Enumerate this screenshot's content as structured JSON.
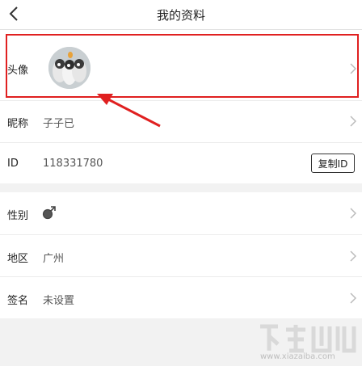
{
  "header": {
    "title": "我的资料"
  },
  "profile": {
    "avatar": {
      "label": "头像"
    },
    "nickname": {
      "label": "昵称",
      "value": "子子已"
    },
    "id": {
      "label": "ID",
      "value": "118331780",
      "copy_label": "复制ID"
    },
    "gender": {
      "label": "性别",
      "icon": "male-symbol-icon"
    },
    "region": {
      "label": "地区",
      "value": "广州"
    },
    "signature": {
      "label": "签名",
      "value": "未设置"
    }
  },
  "watermark": {
    "text": "www.xiazaiba.com"
  },
  "colors": {
    "highlight": "#e02020",
    "background": "#f2f2f2"
  }
}
